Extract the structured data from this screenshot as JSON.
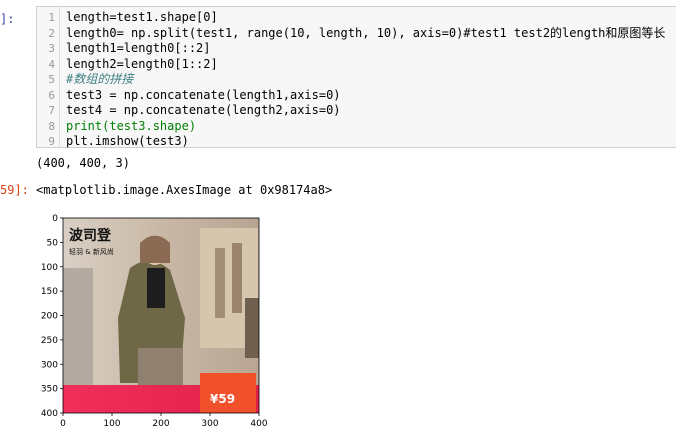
{
  "cell_prompt_in": "]:",
  "code_lines": [
    {
      "n": "1",
      "text": "length=test1.shape[0]"
    },
    {
      "n": "2",
      "text": "length0= np.split(test1, range(10, length, 10), axis=0)#test1 test2的length和原图等长"
    },
    {
      "n": "3",
      "text": "length1=length0[::2]"
    },
    {
      "n": "4",
      "text": "length2=length0[1::2]"
    },
    {
      "n": "5",
      "text": "#数组的拼接"
    },
    {
      "n": "6",
      "text": "test3 = np.concatenate(length1,axis=0)"
    },
    {
      "n": "7",
      "text": "test4 = np.concatenate(length2,axis=0)"
    },
    {
      "n": "8",
      "text": "print(test3.shape)"
    },
    {
      "n": "9",
      "text": "plt.imshow(test3)"
    }
  ],
  "stdout": "(400, 400, 3)",
  "out_prompt": "59]:",
  "out_repr": "<matplotlib.image.AxesImage at 0x98174a8>",
  "image_overlay": {
    "logo_text": "波司登",
    "logo_sub": "轻羽 & 新风尚",
    "price_text": "¥59"
  },
  "chart_data": {
    "type": "image",
    "x_ticks": [
      "0",
      "100",
      "200",
      "300",
      "400"
    ],
    "y_ticks": [
      "0",
      "50",
      "100",
      "150",
      "200",
      "250",
      "300",
      "350",
      "400"
    ],
    "xlim": [
      0,
      400
    ],
    "ylim": [
      400,
      0
    ]
  },
  "colors": {
    "prompt": "#303f9f",
    "out_prompt": "#d84315",
    "banner": "#e8204a"
  }
}
